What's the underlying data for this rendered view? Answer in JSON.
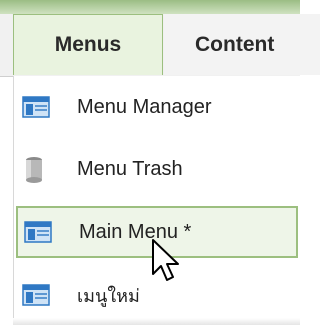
{
  "menubar": {
    "tabs": [
      {
        "label": "Menus",
        "active": true
      },
      {
        "label": "Content",
        "active": false
      }
    ]
  },
  "dropdown": {
    "items": [
      {
        "label": "Menu Manager",
        "icon": "menu-list-icon"
      },
      {
        "label": "Menu Trash",
        "icon": "trash-icon"
      },
      {
        "label": "Main Menu *",
        "icon": "menu-list-icon",
        "active": true
      },
      {
        "label": "เมนูใหม่",
        "icon": "menu-list-icon"
      }
    ]
  },
  "colors": {
    "accent_green": "#9cbf7f",
    "active_bg": "#eef5e8",
    "icon_blue": "#2f78c4"
  }
}
